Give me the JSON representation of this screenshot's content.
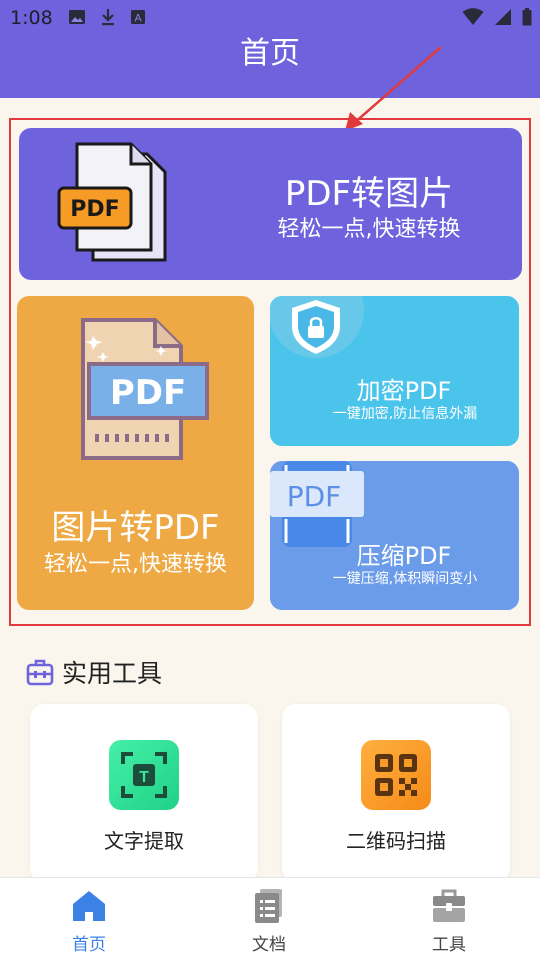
{
  "status_bar": {
    "time": "1:08",
    "left_icons": [
      "image-icon",
      "download-icon",
      "font-a-icon"
    ],
    "right_icons": [
      "wifi-icon",
      "signal-icon",
      "battery-icon"
    ]
  },
  "header": {
    "title": "首页",
    "background": "#6e63dd"
  },
  "feature_cards": {
    "pdf_to_image": {
      "title": "PDF转图片",
      "subtitle": "轻松一点,快速转换",
      "color": "#6e63dd"
    },
    "image_to_pdf": {
      "title": "图片转PDF",
      "subtitle": "轻松一点,快速转换",
      "color": "#eea944"
    },
    "encrypt_pdf": {
      "title": "加密PDF",
      "subtitle": "一键加密,防止信息外漏",
      "color": "#4bc4ec"
    },
    "compress_pdf": {
      "title": "压缩PDF",
      "subtitle": "一键压缩,体积瞬间变小",
      "color": "#6b9cea"
    }
  },
  "pdf_badge_text": "PDF",
  "tools": {
    "title": "实用工具",
    "items": [
      {
        "label": "文字提取",
        "icon": "text-scan-icon",
        "color": "#33e29a"
      },
      {
        "label": "二维码扫描",
        "icon": "qr-code-icon",
        "color": "#f79b27"
      }
    ]
  },
  "bottom_nav": {
    "items": [
      {
        "label": "首页",
        "icon": "home-icon",
        "active": true
      },
      {
        "label": "文档",
        "icon": "document-icon",
        "active": false
      },
      {
        "label": "工具",
        "icon": "toolbox-icon",
        "active": false
      }
    ],
    "active_color": "#3c82e6",
    "inactive_color": "#444444"
  },
  "annotation": {
    "box_color": "#e0393e",
    "arrow_color": "#e0393e"
  }
}
